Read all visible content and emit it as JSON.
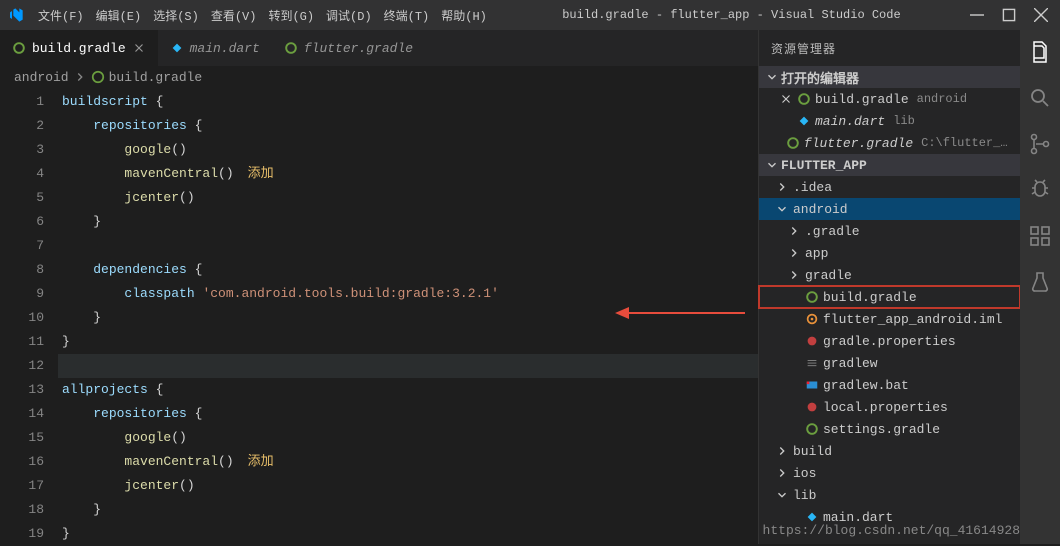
{
  "titlebar": {
    "title": "build.gradle - flutter_app - Visual Studio Code",
    "menus": [
      "文件(F)",
      "编辑(E)",
      "选择(S)",
      "查看(V)",
      "转到(G)",
      "调试(D)",
      "终端(T)",
      "帮助(H)"
    ]
  },
  "tabs": [
    {
      "label": "build.gradle",
      "icon": "gradle",
      "active": true,
      "italic": false
    },
    {
      "label": "main.dart",
      "icon": "dart",
      "active": false,
      "italic": true
    },
    {
      "label": "flutter.gradle",
      "icon": "gradle",
      "active": false,
      "italic": true
    }
  ],
  "breadcrumb": {
    "seg1": "android",
    "seg2": "build.gradle"
  },
  "annotations": {
    "add": "添加"
  },
  "code": {
    "lines": [
      [
        {
          "t": "buildscript",
          "c": "c-kw"
        },
        {
          "t": " {",
          "c": "c-p"
        }
      ],
      [
        {
          "t": "    "
        },
        {
          "t": "repositories",
          "c": "c-kw"
        },
        {
          "t": " {",
          "c": "c-p"
        }
      ],
      [
        {
          "t": "        "
        },
        {
          "t": "google",
          "c": "c-fn"
        },
        {
          "t": "()",
          "c": "c-p"
        }
      ],
      [
        {
          "t": "        "
        },
        {
          "t": "mavenCentral",
          "c": "c-fn"
        },
        {
          "t": "()",
          "c": "c-p"
        },
        {
          "annot": "add"
        }
      ],
      [
        {
          "t": "        "
        },
        {
          "t": "jcenter",
          "c": "c-fn"
        },
        {
          "t": "()",
          "c": "c-p"
        }
      ],
      [
        {
          "t": "    }",
          "c": "c-p"
        }
      ],
      [],
      [
        {
          "t": "    "
        },
        {
          "t": "dependencies",
          "c": "c-kw"
        },
        {
          "t": " {",
          "c": "c-p"
        }
      ],
      [
        {
          "t": "        "
        },
        {
          "t": "classpath",
          "c": "c-kw"
        },
        {
          "t": " "
        },
        {
          "t": "'com.android.tools.build:gradle:3.2.1'",
          "c": "c-str"
        }
      ],
      [
        {
          "t": "    }",
          "c": "c-p"
        }
      ],
      [
        {
          "t": "}",
          "c": "c-p"
        }
      ],
      [],
      [
        {
          "t": "allprojects",
          "c": "c-kw"
        },
        {
          "t": " {",
          "c": "c-p"
        }
      ],
      [
        {
          "t": "    "
        },
        {
          "t": "repositories",
          "c": "c-kw"
        },
        {
          "t": " {",
          "c": "c-p"
        }
      ],
      [
        {
          "t": "        "
        },
        {
          "t": "google",
          "c": "c-fn"
        },
        {
          "t": "()",
          "c": "c-p"
        }
      ],
      [
        {
          "t": "        "
        },
        {
          "t": "mavenCentral",
          "c": "c-fn"
        },
        {
          "t": "()",
          "c": "c-p"
        },
        {
          "annot": "add"
        }
      ],
      [
        {
          "t": "        "
        },
        {
          "t": "jcenter",
          "c": "c-fn"
        },
        {
          "t": "()",
          "c": "c-p"
        }
      ],
      [
        {
          "t": "    }",
          "c": "c-p"
        }
      ],
      [
        {
          "t": "}",
          "c": "c-p"
        }
      ]
    ],
    "currentLine": 12
  },
  "sidebar": {
    "title": "资源管理器",
    "openEditors": {
      "label": "打开的编辑器",
      "items": [
        {
          "label": "build.gradle",
          "dim": "android",
          "icon": "gradle",
          "close": true
        },
        {
          "label": "main.dart",
          "dim": "lib",
          "icon": "dart",
          "italic": true
        },
        {
          "label": "flutter.gradle",
          "dim": "C:\\flutter_windows\\fl...",
          "icon": "gradle",
          "italic": true
        }
      ]
    },
    "project": {
      "label": "FLUTTER_APP",
      "tree": [
        {
          "indent": 1,
          "chev": "r",
          "label": ".idea",
          "type": "folder"
        },
        {
          "indent": 1,
          "chev": "d",
          "label": "android",
          "type": "folder",
          "sel": true
        },
        {
          "indent": 2,
          "chev": "r",
          "label": ".gradle",
          "type": "folder"
        },
        {
          "indent": 2,
          "chev": "r",
          "label": "app",
          "type": "folder"
        },
        {
          "indent": 2,
          "chev": "r",
          "label": "gradle",
          "type": "folder"
        },
        {
          "indent": 2,
          "icon": "gradle",
          "label": "build.gradle",
          "hl": true
        },
        {
          "indent": 2,
          "icon": "xml",
          "label": "flutter_app_android.iml"
        },
        {
          "indent": 2,
          "icon": "props",
          "label": "gradle.properties"
        },
        {
          "indent": 2,
          "icon": "file",
          "label": "gradlew"
        },
        {
          "indent": 2,
          "icon": "bat",
          "label": "gradlew.bat"
        },
        {
          "indent": 2,
          "icon": "props",
          "label": "local.properties"
        },
        {
          "indent": 2,
          "icon": "gradle",
          "label": "settings.gradle"
        },
        {
          "indent": 1,
          "chev": "r",
          "label": "build",
          "type": "folder"
        },
        {
          "indent": 1,
          "chev": "r",
          "label": "ios",
          "type": "folder"
        },
        {
          "indent": 1,
          "chev": "d",
          "label": "lib",
          "type": "folder"
        },
        {
          "indent": 2,
          "icon": "dart",
          "label": "main.dart"
        }
      ]
    }
  },
  "watermark": "https://blog.csdn.net/qq_41614928"
}
